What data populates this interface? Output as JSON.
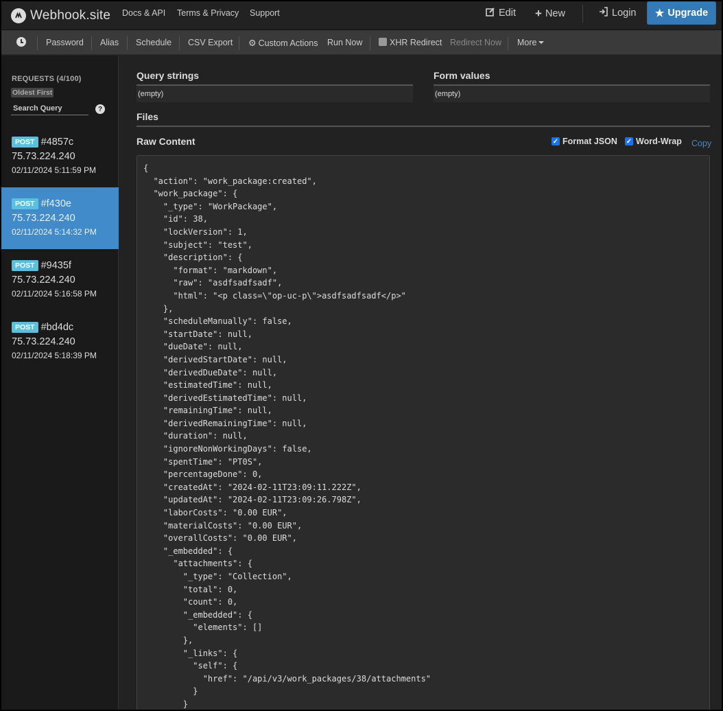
{
  "navbar": {
    "brand": "Webhook.site",
    "links": [
      "Docs & API",
      "Terms & Privacy",
      "Support"
    ],
    "edit": "Edit",
    "new": "New",
    "login": "Login",
    "upgrade": "Upgrade"
  },
  "toolbar": {
    "password": "Password",
    "alias": "Alias",
    "schedule": "Schedule",
    "csv_export": "CSV Export",
    "custom_actions": "Custom Actions",
    "run_now": "Run Now",
    "xhr_redirect": "XHR Redirect",
    "redirect_now": "Redirect Now",
    "more": "More"
  },
  "sidebar": {
    "requests_label": "REQUESTS (4/100)",
    "sort_label": "Oldest First",
    "search_placeholder": "Search Query",
    "requests": [
      {
        "method": "POST",
        "id": "#4857c",
        "ip": "75.73.224.240",
        "time": "02/11/2024 5:11:59 PM"
      },
      {
        "method": "POST",
        "id": "#f430e",
        "ip": "75.73.224.240",
        "time": "02/11/2024 5:14:32 PM"
      },
      {
        "method": "POST",
        "id": "#9435f",
        "ip": "75.73.224.240",
        "time": "02/11/2024 5:16:58 PM"
      },
      {
        "method": "POST",
        "id": "#bd4dc",
        "ip": "75.73.224.240",
        "time": "02/11/2024 5:18:39 PM"
      }
    ]
  },
  "main": {
    "query_strings_title": "Query strings",
    "query_strings_value": "(empty)",
    "form_values_title": "Form values",
    "form_values_value": "(empty)",
    "files_title": "Files",
    "raw_content_title": "Raw Content",
    "format_json_label": "Format JSON",
    "word_wrap_label": "Word-Wrap",
    "copy_label": "Copy",
    "raw_content": "{\n  \"action\": \"work_package:created\",\n  \"work_package\": {\n    \"_type\": \"WorkPackage\",\n    \"id\": 38,\n    \"lockVersion\": 1,\n    \"subject\": \"test\",\n    \"description\": {\n      \"format\": \"markdown\",\n      \"raw\": \"asdfsadfsadf\",\n      \"html\": \"<p class=\\\"op-uc-p\\\">asdfsadfsadf</p>\"\n    },\n    \"scheduleManually\": false,\n    \"startDate\": null,\n    \"dueDate\": null,\n    \"derivedStartDate\": null,\n    \"derivedDueDate\": null,\n    \"estimatedTime\": null,\n    \"derivedEstimatedTime\": null,\n    \"remainingTime\": null,\n    \"derivedRemainingTime\": null,\n    \"duration\": null,\n    \"ignoreNonWorkingDays\": false,\n    \"spentTime\": \"PT0S\",\n    \"percentageDone\": 0,\n    \"createdAt\": \"2024-02-11T23:09:11.222Z\",\n    \"updatedAt\": \"2024-02-11T23:09:26.798Z\",\n    \"laborCosts\": \"0.00 EUR\",\n    \"materialCosts\": \"0.00 EUR\",\n    \"overallCosts\": \"0.00 EUR\",\n    \"_embedded\": {\n      \"attachments\": {\n        \"_type\": \"Collection\",\n        \"total\": 0,\n        \"count\": 0,\n        \"_embedded\": {\n          \"elements\": []\n        },\n        \"_links\": {\n          \"self\": {\n            \"href\": \"/api/v3/work_packages/38/attachments\"\n          }\n        }"
  }
}
